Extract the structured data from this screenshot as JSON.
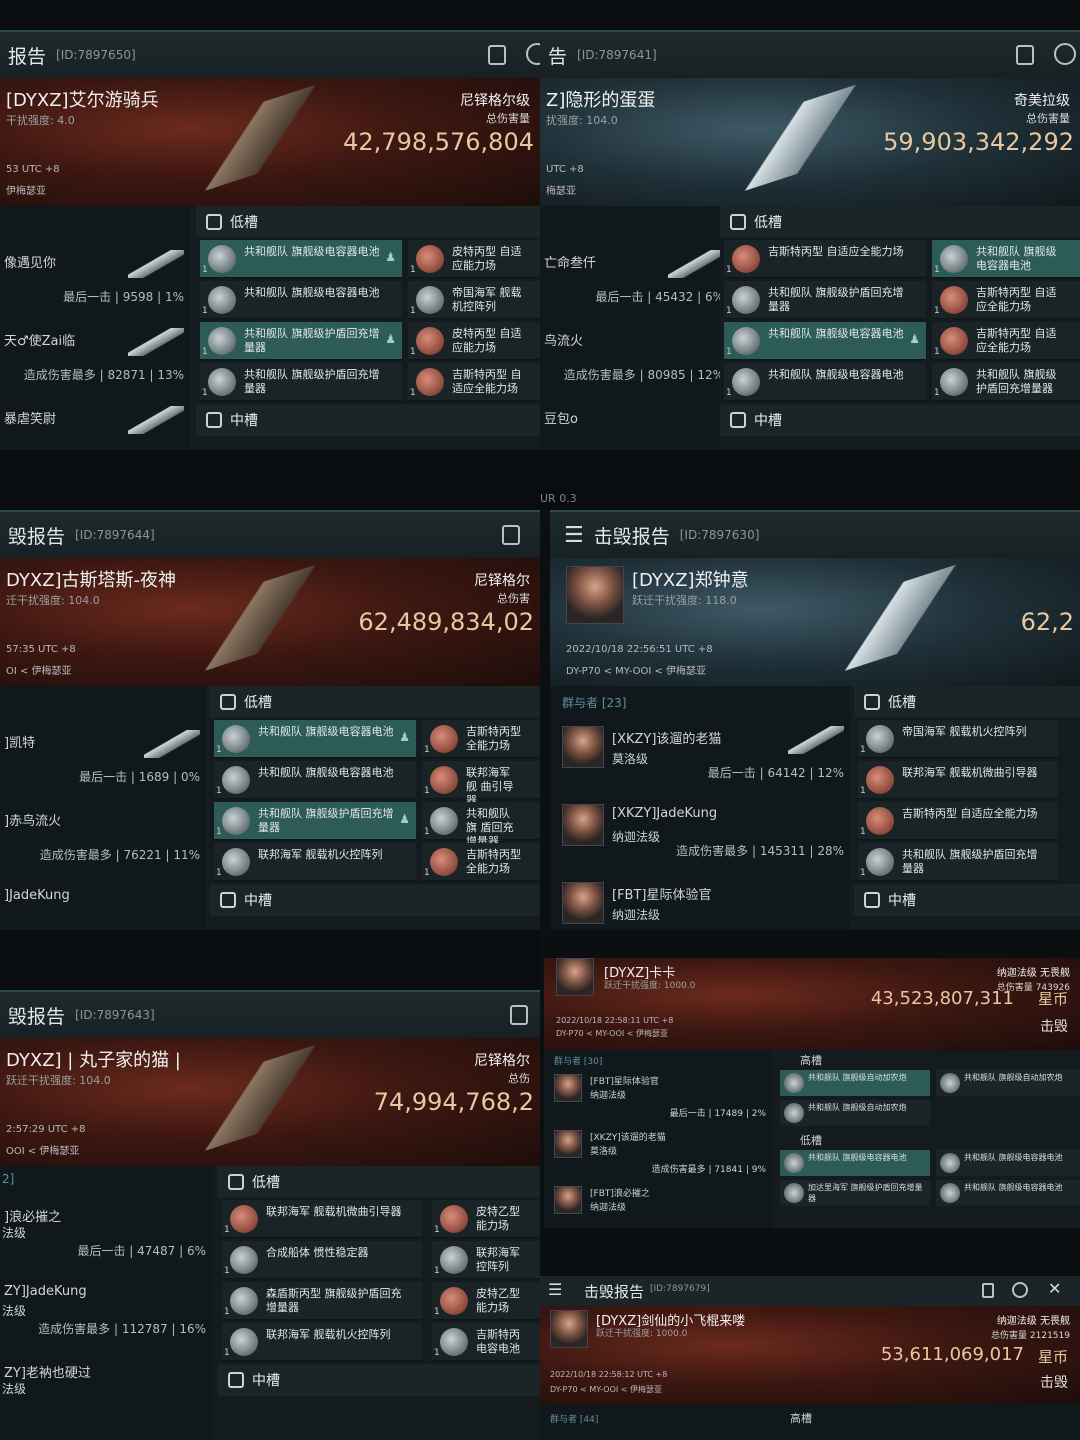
{
  "p1": {
    "title": "报告",
    "id": "[ID:7897650]",
    "name": "[DYXZ]艾尔游骑兵",
    "sub": "干扰强度: 4.0",
    "t1": "53 UTC +8",
    "t2": "伊梅瑟亚",
    "vtype": "尼铎格尔级",
    "dmg": "总伤害量",
    "value": "42,798,576,804",
    "att": [
      {
        "n": "像遇见你",
        "s": "最后一击 | 9598 | 1%"
      },
      {
        "n": "天♂使Zai临",
        "s": "造成伤害最多 | 82871 | 13%"
      },
      {
        "n": "暴虐笑尉",
        "s": ""
      }
    ],
    "sec1": "低槽",
    "sec2": "中槽",
    "mods": [
      {
        "l": "共和舰队 旗舰级电容器电池",
        "q": "1",
        "hl": true
      },
      {
        "l": "皮特丙型 自适应能力场",
        "q": "1",
        "hl": false
      },
      {
        "l": "共和舰队 旗舰级电容器电池",
        "q": "1",
        "hl": false
      },
      {
        "l": "帝国海军 舰载机控阵列",
        "q": "1",
        "hl": false
      },
      {
        "l": "共和舰队 旗舰级护盾回充增量器",
        "q": "1",
        "hl": true
      },
      {
        "l": "皮特丙型 自适应能力场",
        "q": "1",
        "hl": false
      },
      {
        "l": "共和舰队 旗舰级护盾回充增量器",
        "q": "1",
        "hl": false
      },
      {
        "l": "吉斯特丙型 自适应全能力场",
        "q": "1",
        "hl": false
      }
    ]
  },
  "p2": {
    "title": "告",
    "id": "[ID:7897641]",
    "name": "Z]隐形的蛋蛋",
    "sub": "扰强度: 104.0",
    "t1": "UTC +8",
    "t2": "梅瑟亚",
    "vtype": "奇美拉级",
    "dmg": "总伤害量",
    "value": "59,903,342,292",
    "att": [
      {
        "n": "亡命叁仟",
        "s": "最后一击 | 45432 | 6%"
      },
      {
        "n": "鸟流火",
        "s": "造成伤害最多 | 80985 | 12%"
      },
      {
        "n": "豆包o",
        "s": ""
      }
    ],
    "sec1": "低槽",
    "sec2": "中槽",
    "mods": [
      {
        "l": "吉斯特丙型 自适应全能力场",
        "q": "1",
        "hl": false
      },
      {
        "l": "共和舰队 旗舰级电容器电池",
        "q": "1",
        "hl": true
      },
      {
        "l": "共和舰队 旗舰级护盾回充增量器",
        "q": "1",
        "hl": false
      },
      {
        "l": "吉斯特丙型 自适应全能力场",
        "q": "1",
        "hl": false
      },
      {
        "l": "共和舰队 旗舰级电容器电池",
        "q": "1",
        "hl": true
      },
      {
        "l": "吉斯特丙型 自适应全能力场",
        "q": "1",
        "hl": false
      },
      {
        "l": "共和舰队 旗舰级电容器电池",
        "q": "1",
        "hl": false
      },
      {
        "l": "共和舰队 旗舰级护盾回充增量器",
        "q": "1",
        "hl": false
      }
    ]
  },
  "p3": {
    "title": "毁报告",
    "id": "[ID:7897644]",
    "name": "DYXZ]古斯塔斯-夜神",
    "sub": "迁干扰强度: 104.0",
    "t1": "57:35 UTC +8",
    "t2": "OI < 伊梅瑟亚",
    "vtype": "尼铎格尔",
    "dmg": "总伤害",
    "value": "62,489,834,02",
    "att": [
      {
        "n": "]凯特",
        "s": "最后一击 | 1689 | 0%"
      },
      {
        "n": "]赤鸟流火",
        "s": "造成伤害最多 | 76221 | 11%"
      },
      {
        "n": "]JadeKung",
        "s": ""
      }
    ],
    "sec1": "低槽",
    "sec2": "中槽",
    "mods": [
      {
        "l": "共和舰队 旗舰级电容器电池",
        "q": "1",
        "hl": true
      },
      {
        "l": "吉斯特丙型 全能力场",
        "q": "1",
        "hl": false
      },
      {
        "l": "共和舰队 旗舰级电容器电池",
        "q": "1",
        "hl": false
      },
      {
        "l": "联邦海军 舰 曲引导器",
        "q": "1",
        "hl": false
      },
      {
        "l": "共和舰队 旗舰级护盾回充增量器",
        "q": "1",
        "hl": true
      },
      {
        "l": "共和舰队 旗 盾回充增量器",
        "q": "1",
        "hl": false
      },
      {
        "l": "联邦海军 舰载机火控阵列",
        "q": "1",
        "hl": false
      },
      {
        "l": "吉斯特丙型 全能力场",
        "q": "1",
        "hl": false
      }
    ]
  },
  "p4": {
    "title": "击毁报告",
    "id": "[ID:7897630]",
    "name": "[DYXZ]郑钟意",
    "sub": "跃迁干扰强度: 118.0",
    "t1": "2022/10/18 22:56:51 UTC +8",
    "t2": "DY-P70 < MY-OOI < 伊梅瑟亚",
    "value": "62,2",
    "count": "群与者 [23]",
    "att": [
      {
        "n": "[XKZY]该遛的老猫",
        "c": "莫洛级",
        "s": "最后一击 | 64142 | 12%"
      },
      {
        "n": "[XKZY]JadeKung",
        "c": "纳迦法级",
        "s": "造成伤害最多 | 145311 | 28%"
      },
      {
        "n": "[FBT]星际体验官",
        "c": "纳迦法级",
        "s": ""
      }
    ],
    "sec1": "低槽",
    "sec2": "中槽",
    "mods": [
      {
        "l": "帝国海军 舰载机火控阵列",
        "q": "1",
        "hl": false
      },
      {
        "l": "联邦海军 舰载机微曲引导器",
        "q": "1",
        "hl": false
      },
      {
        "l": "吉斯特丙型 自适应全能力场",
        "q": "1",
        "hl": false
      },
      {
        "l": "共和舰队 旗舰级护盾回充增量器",
        "q": "1",
        "hl": false
      }
    ]
  },
  "p5": {
    "title": "毁报告",
    "id": "[ID:7897643]",
    "name": "DYXZ] | 丸子家的猫 |",
    "sub": "跃迁干扰强度: 104.0",
    "t1": "2:57:29 UTC +8",
    "t2": "OOI < 伊梅瑟亚",
    "vtype": "尼铎格尔",
    "dmg": "总伤",
    "value": "74,994,768,2",
    "count": "2]",
    "att": [
      {
        "n": "]浪必摧之",
        "c": "法级",
        "s": "最后一击 | 47487 | 6%"
      },
      {
        "n": "ZY]JadeKung",
        "c": "法级",
        "s": "造成伤害最多 | 112787 | 16%"
      },
      {
        "n": "ZY]老衲也硬过",
        "c": "法级",
        "s": ""
      }
    ],
    "sec1": "低槽",
    "sec2": "中槽",
    "mods": [
      {
        "l": "联邦海军 舰载机微曲引导器",
        "q": "1",
        "hl": false
      },
      {
        "l": "皮特乙型 能力场",
        "q": "1",
        "hl": false
      },
      {
        "l": "合成船体 惯性稳定器",
        "q": "1",
        "hl": false
      },
      {
        "l": "联邦海军 控阵列",
        "q": "1",
        "hl": false
      },
      {
        "l": "森盾斯丙型 旗舰级护盾回充增量器",
        "q": "1",
        "hl": false
      },
      {
        "l": "皮特乙型 能力场",
        "q": "1",
        "hl": false
      },
      {
        "l": "联邦海军 舰载机火控阵列",
        "q": "1",
        "hl": false
      },
      {
        "l": "吉斯特丙 电容电池",
        "q": "1",
        "hl": false
      }
    ]
  },
  "p6": {
    "name": "[DYXZ]卡卡",
    "sub": "跃迁干扰强度: 1000.0",
    "t1": "2022/10/18 22:58:11 UTC +8",
    "t2": "DY-P70 < MY-OOI < 伊梅瑟亚",
    "vtype": "纳迦法级 无畏舰",
    "dmg": "总伤害量 743926",
    "value": "43,523,807,311",
    "unit": "星币",
    "kill": "击毁",
    "count": "群与者 [30]",
    "att": [
      {
        "n": "[FBT]星际体验官",
        "c": "纳迦法级",
        "s": "最后一击 | 17489 | 2%"
      },
      {
        "n": "[XKZY]该遛的老猫",
        "c": "莫洛级",
        "s": "造成伤害最多 | 71841 | 9%"
      },
      {
        "n": "[FBT]浪必摧之",
        "c": "纳迦法级",
        "s": ""
      }
    ],
    "hi": "高槽",
    "lo": "低槽",
    "mods": [
      {
        "l": "共和舰队 旗舰级自动加农炮"
      },
      {
        "l": "共和舰队 旗舰级自动加农炮"
      },
      {
        "l": "共和舰队 旗舰级自动加农炮"
      },
      {
        "l": "共和舰队 旗舰级电容器电池"
      },
      {
        "l": "共和舰队 旗舰级电容器电池"
      },
      {
        "l": "加达里海军 旗舰级护盾回充增量器"
      },
      {
        "l": "共和舰队 旗舰级电容器电池"
      }
    ]
  },
  "p7": {
    "title": "击毁报告",
    "id": "[ID:7897679]",
    "name": "[DYXZ]剑仙的小飞棍来喽",
    "sub": "跃迁干扰强度: 1000.0",
    "t1": "2022/10/18 22:58:12 UTC +8",
    "t2": "DY-P70 < MY-OOI < 伊梅瑟亚",
    "vtype": "纳迦法级 无畏舰",
    "dmg": "总伤害量 2121519",
    "value": "53,611,069,017",
    "unit": "星币",
    "kill": "击毁",
    "count": "群与者 [44]",
    "hi": "高槽"
  },
  "divider": "UR 0.3"
}
